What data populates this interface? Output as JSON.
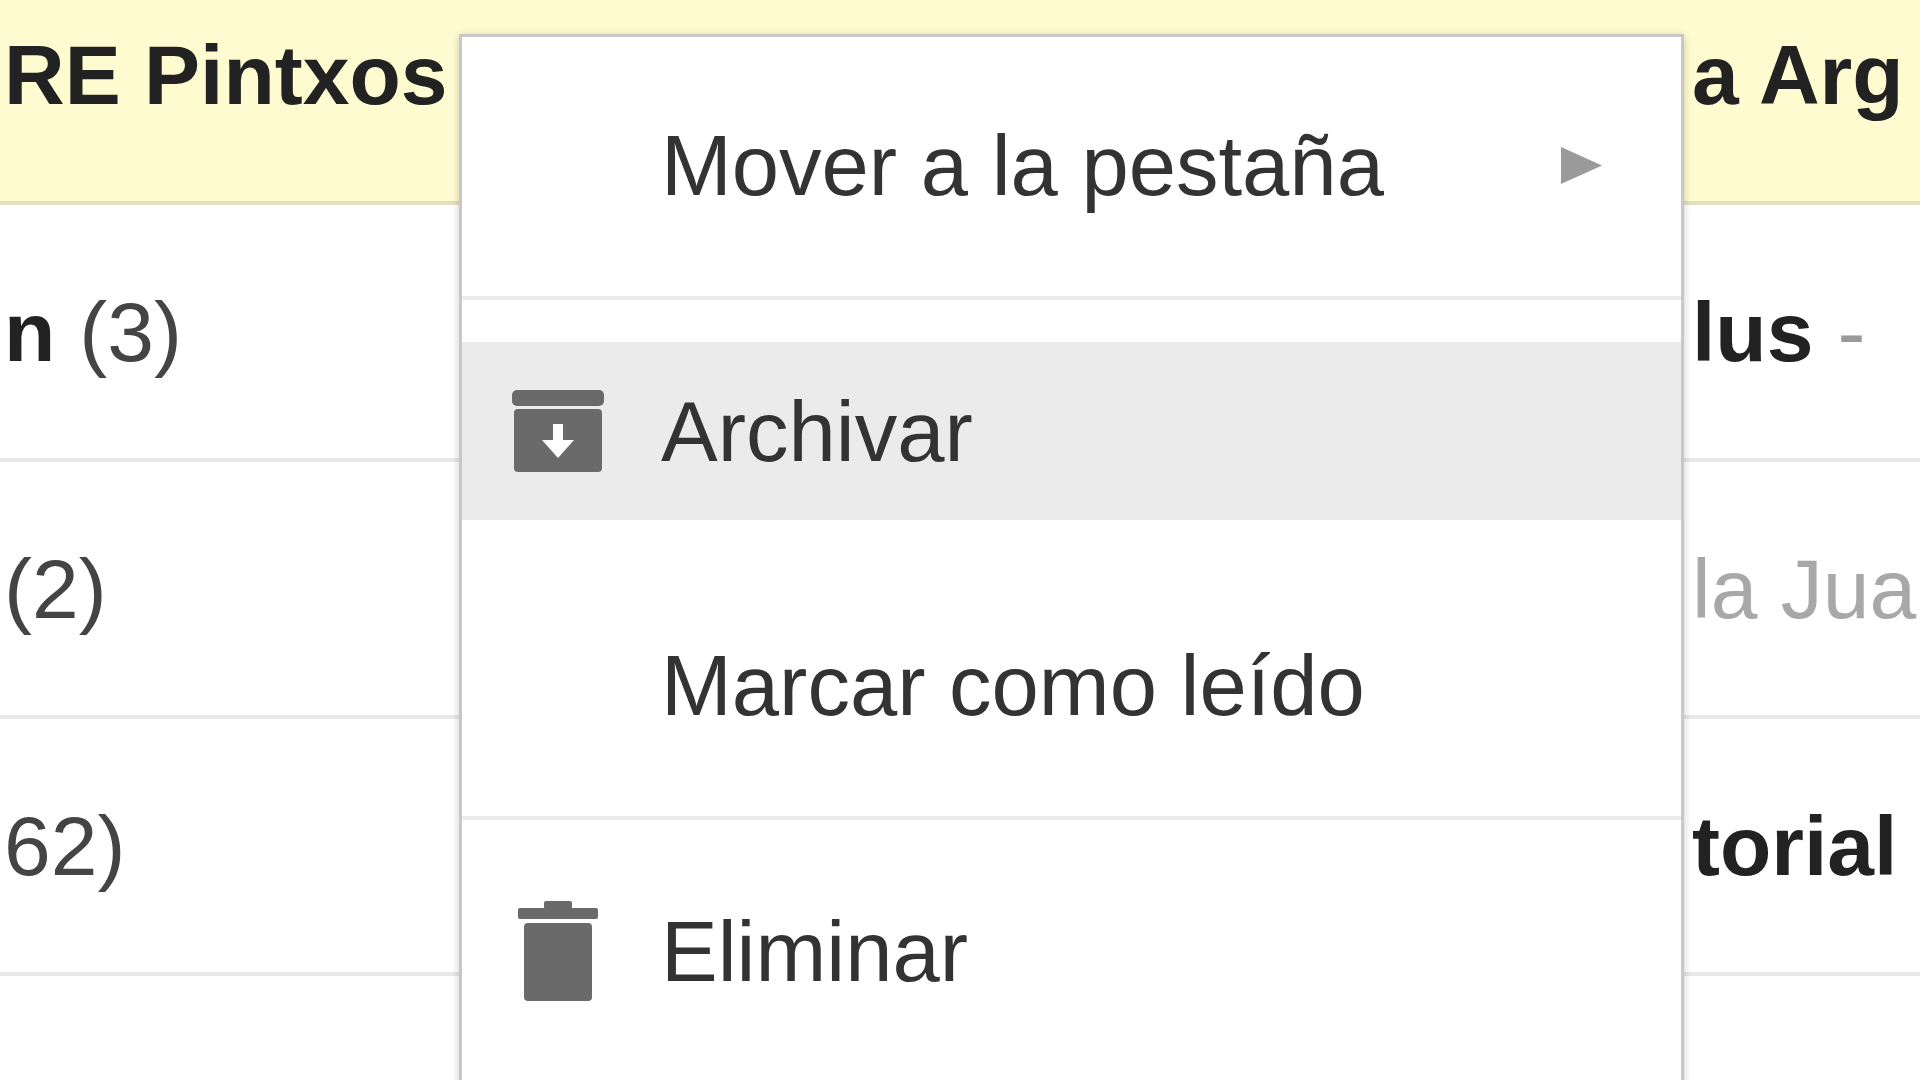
{
  "rows": [
    {
      "selected": true,
      "unread": true,
      "sender": "RE Pintxos",
      "subject": "a Arg"
    },
    {
      "selected": false,
      "unread": true,
      "sender": "n",
      "count": "(3)",
      "subject": "lus",
      "snippet": "-"
    },
    {
      "selected": false,
      "unread": false,
      "count": "(2)",
      "subject": "la Jua"
    },
    {
      "selected": false,
      "unread": true,
      "count": "62)",
      "subject": "torial"
    }
  ],
  "context_menu": {
    "items": [
      {
        "kind": "submenu",
        "label": "Mover a la pestaña",
        "highlighted": false
      },
      {
        "kind": "separator"
      },
      {
        "kind": "archive",
        "label": "Archivar",
        "highlighted": true
      },
      {
        "kind": "plain",
        "label": "Marcar como leído",
        "highlighted": false
      },
      {
        "kind": "separator"
      },
      {
        "kind": "delete",
        "label": "Eliminar",
        "highlighted": false
      }
    ]
  }
}
